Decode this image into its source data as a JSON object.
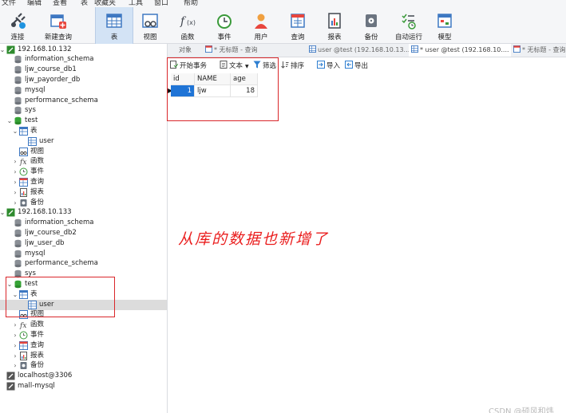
{
  "menu": [
    "文件",
    "编辑",
    "查看",
    "表",
    "收藏夹",
    "工具",
    "窗口",
    "帮助"
  ],
  "toolbar": [
    {
      "label": "连接",
      "icon": "plug-icon"
    },
    {
      "label": "新建查询",
      "icon": "new-query-icon"
    },
    {
      "label": "表",
      "icon": "table-icon",
      "active": true
    },
    {
      "label": "视图",
      "icon": "view-icon"
    },
    {
      "label": "函数",
      "icon": "function-icon"
    },
    {
      "label": "事件",
      "icon": "clock-icon"
    },
    {
      "label": "用户",
      "icon": "user-icon"
    },
    {
      "label": "查询",
      "icon": "query-icon"
    },
    {
      "label": "报表",
      "icon": "report-icon"
    },
    {
      "label": "备份",
      "icon": "backup-icon"
    },
    {
      "label": "自动运行",
      "icon": "schedule-icon"
    },
    {
      "label": "模型",
      "icon": "model-icon"
    }
  ],
  "tabs": [
    {
      "label": "对象"
    },
    {
      "label": "* 无标题 - 查询"
    },
    {
      "label": "user @test (192.168.10.13..."
    },
    {
      "label": "* user @test (192.168.10...."
    },
    {
      "label": "* 无标题 - 查询"
    }
  ],
  "subtoolbar": {
    "begin_tx": "开始事务",
    "text": "文本",
    "filter": "筛选",
    "sort": "排序",
    "import": "导入",
    "export": "导出"
  },
  "grid": {
    "columns": [
      "id",
      "NAME",
      "age"
    ],
    "rows": [
      [
        "1",
        "ljw",
        "18"
      ]
    ]
  },
  "tree": [
    {
      "label": "192.168.10.132",
      "type": "connection",
      "level": 0,
      "expanded": true
    },
    {
      "label": "information_schema",
      "type": "database",
      "level": 1
    },
    {
      "label": "ljw_course_db1",
      "type": "database",
      "level": 1
    },
    {
      "label": "ljw_payorder_db",
      "type": "database",
      "level": 1
    },
    {
      "label": "mysql",
      "type": "database",
      "level": 1
    },
    {
      "label": "performance_schema",
      "type": "database",
      "level": 1
    },
    {
      "label": "sys",
      "type": "database",
      "level": 1
    },
    {
      "label": "test",
      "type": "database-open",
      "level": 1,
      "expanded": true
    },
    {
      "label": "表",
      "type": "tables",
      "level": 2,
      "expanded": true
    },
    {
      "label": "user",
      "type": "table",
      "level": 3
    },
    {
      "label": "视图",
      "type": "views",
      "level": 2
    },
    {
      "label": "函数",
      "type": "functions",
      "level": 2,
      "collapsed": true
    },
    {
      "label": "事件",
      "type": "events",
      "level": 2,
      "collapsed": true
    },
    {
      "label": "查询",
      "type": "queries",
      "level": 2,
      "collapsed": true
    },
    {
      "label": "报表",
      "type": "reports",
      "level": 2,
      "collapsed": true
    },
    {
      "label": "备份",
      "type": "backups",
      "level": 2,
      "collapsed": true
    },
    {
      "label": "192.168.10.133",
      "type": "connection",
      "level": 0,
      "expanded": true
    },
    {
      "label": "information_schema",
      "type": "database",
      "level": 1
    },
    {
      "label": "ljw_course_db2",
      "type": "database",
      "level": 1
    },
    {
      "label": "ljw_user_db",
      "type": "database",
      "level": 1
    },
    {
      "label": "mysql",
      "type": "database",
      "level": 1
    },
    {
      "label": "performance_schema",
      "type": "database",
      "level": 1
    },
    {
      "label": "sys",
      "type": "database",
      "level": 1
    },
    {
      "label": "test",
      "type": "database-open",
      "level": 1,
      "expanded": true
    },
    {
      "label": "表",
      "type": "tables",
      "level": 2,
      "expanded": true
    },
    {
      "label": "user",
      "type": "table",
      "level": 3,
      "selected": true
    },
    {
      "label": "视图",
      "type": "views",
      "level": 2
    },
    {
      "label": "函数",
      "type": "functions",
      "level": 2,
      "collapsed": true
    },
    {
      "label": "事件",
      "type": "events",
      "level": 2,
      "collapsed": true
    },
    {
      "label": "查询",
      "type": "queries",
      "level": 2,
      "collapsed": true
    },
    {
      "label": "报表",
      "type": "reports",
      "level": 2,
      "collapsed": true
    },
    {
      "label": "备份",
      "type": "backups",
      "level": 2,
      "collapsed": true
    },
    {
      "label": "localhost@3306",
      "type": "connection-off",
      "level": 0
    },
    {
      "label": "mall-mysql",
      "type": "connection-off",
      "level": 0
    }
  ],
  "annotation": "从库的数据也新增了",
  "watermark": "CSDN @硕风和炜",
  "colors": {
    "annotation": "#ea1d1d",
    "highlight_box": "#d9262a",
    "selected_row": "#dcdcdc",
    "active_tab": "#d3e3f5"
  }
}
